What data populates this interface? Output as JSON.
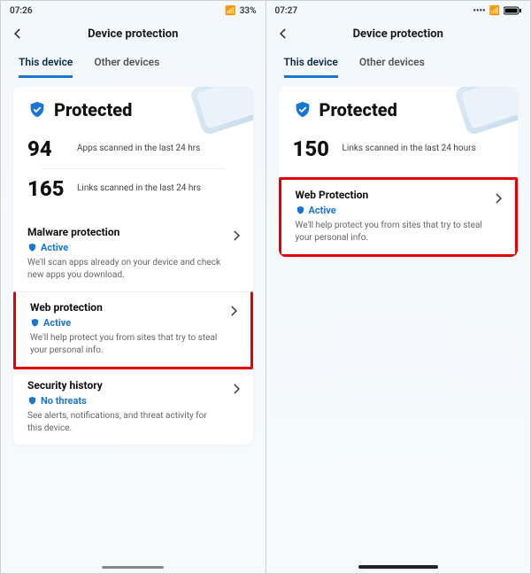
{
  "left": {
    "status": {
      "time": "07:26",
      "battery": "33%",
      "indicators": "⋮ ⊕ 🛡"
    },
    "title": "Device protection",
    "tabs": {
      "this": "This device",
      "other": "Other devices"
    },
    "hero": {
      "label": "Protected"
    },
    "stats": {
      "apps_num": "94",
      "apps_text": "Apps scanned in\nthe last 24 hrs",
      "links_num": "165",
      "links_text": "Links scanned\nin the last 24 hrs"
    },
    "sections": {
      "malware": {
        "title": "Malware protection",
        "status": "Active",
        "desc": "We'll scan apps already on your device and check new apps you download."
      },
      "web": {
        "title": "Web protection",
        "status": "Active",
        "desc": "We'll help protect you from sites that try to steal your personal info."
      },
      "history": {
        "title": "Security history",
        "status": "No threats",
        "desc": "See alerts, notifications, and threat activity for this device."
      }
    }
  },
  "right": {
    "status": {
      "time": "07:27",
      "battery_icon": "■"
    },
    "title": "Device protection",
    "tabs": {
      "this": "This device",
      "other": "Other devices"
    },
    "hero": {
      "label": "Protected"
    },
    "stats": {
      "links_num": "150",
      "links_text": "Links scanned in\nthe last 24 hours"
    },
    "sections": {
      "web": {
        "title": "Web Protection",
        "status": "Active",
        "desc": "We'll help protect you from sites that try to steal your personal info."
      }
    }
  }
}
